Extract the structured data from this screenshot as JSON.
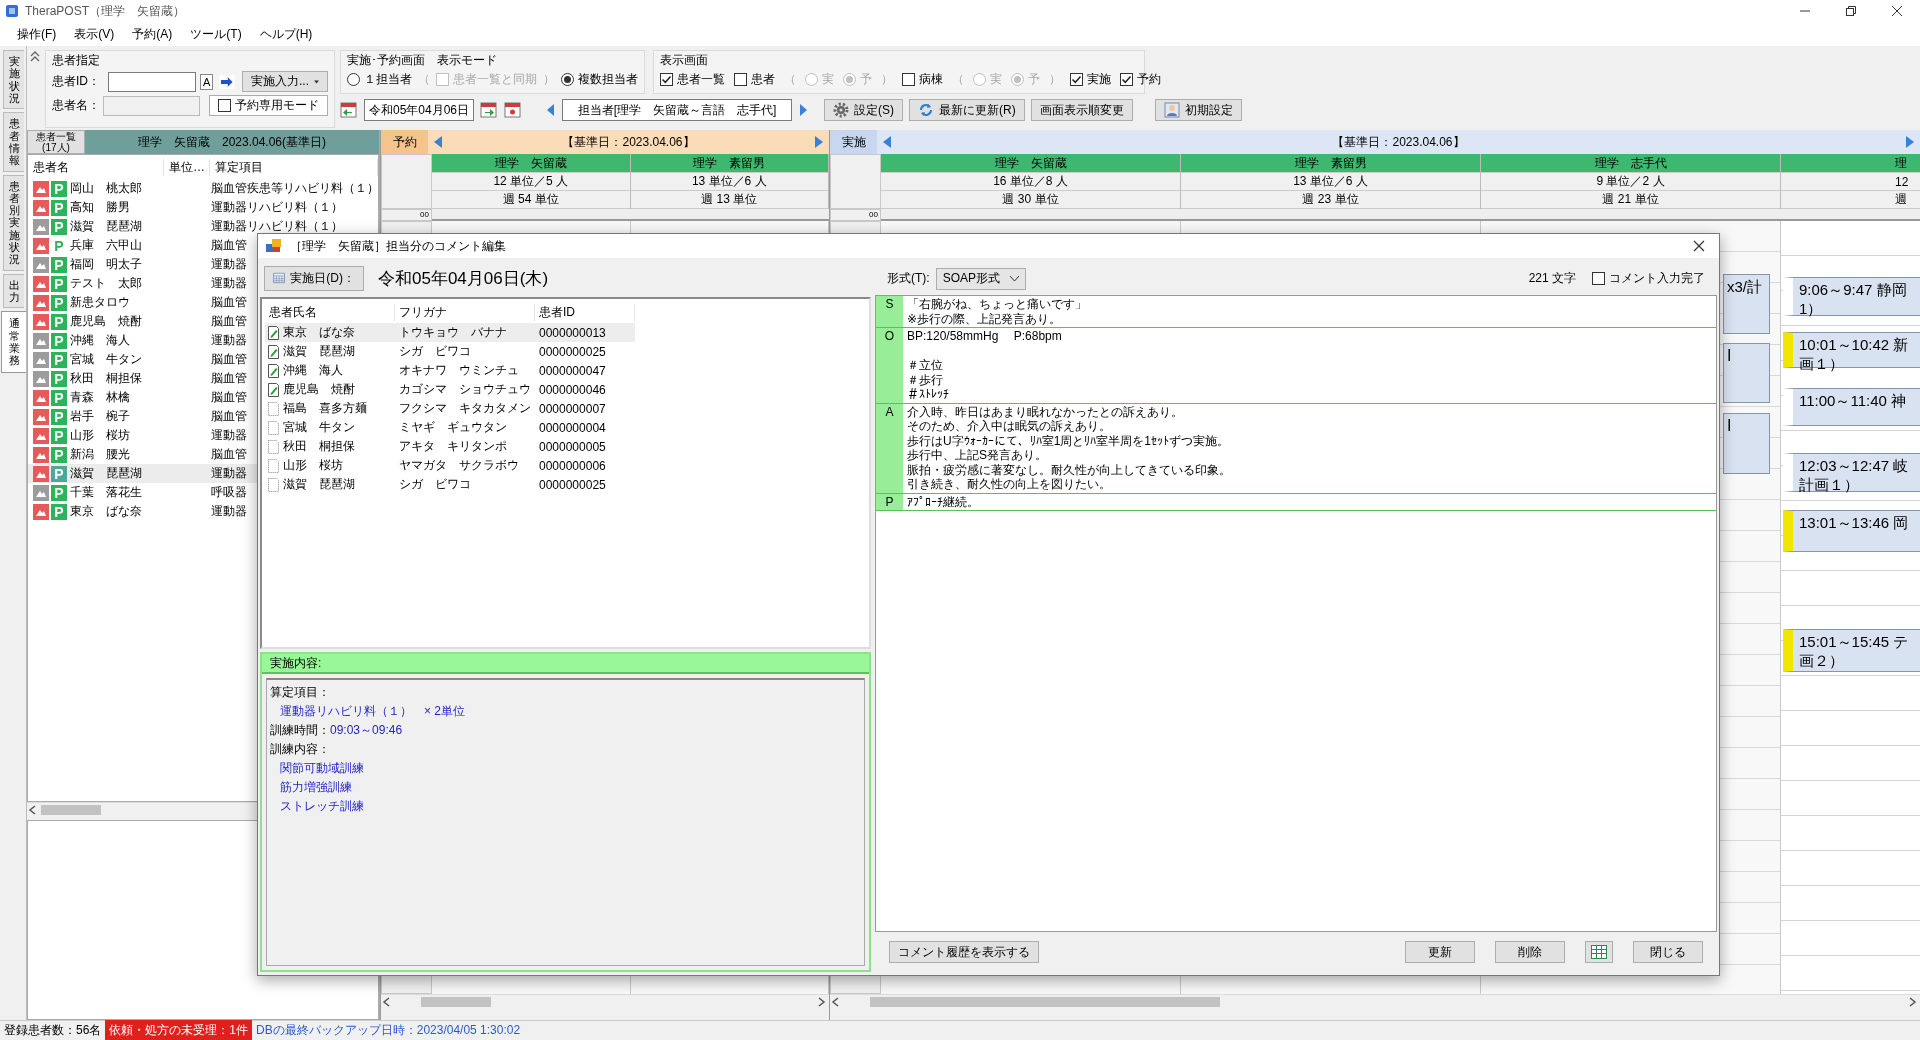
{
  "window": {
    "title": "TheraPOST（理学　矢留蔵）"
  },
  "menu": [
    {
      "label": "操作(F)"
    },
    {
      "label": "表示(V)"
    },
    {
      "label": "予約(A)"
    },
    {
      "label": "ツール(T)"
    },
    {
      "label": "ヘルプ(H)"
    }
  ],
  "side_tabs": [
    {
      "label": "実施状況",
      "selected": false
    },
    {
      "label": "患者情報",
      "selected": false
    },
    {
      "label": "患者別実施状況",
      "selected": false
    },
    {
      "label": "出力",
      "selected": false
    },
    {
      "label": "通常業務",
      "selected": true
    }
  ],
  "patient_spec": {
    "title": "患者指定",
    "id_label": "患者ID：",
    "id_button": "A",
    "input_menu": "実施入力...",
    "name_label": "患者名：",
    "reserve_only": {
      "label": "予約専用モード",
      "checked": false
    }
  },
  "display_mode": {
    "title": "実施･予約画面　表示モード",
    "single": {
      "label": "１担当者",
      "selected": false
    },
    "sync": {
      "open": "（",
      "label": "患者一覧と同期",
      "checked": false,
      "disabled": true,
      "close": "）"
    },
    "multi": {
      "label": "複数担当者",
      "selected": true
    }
  },
  "view_panel": {
    "title": "表示画面",
    "items": [
      {
        "label": "患者一覧",
        "checked": true
      },
      {
        "label": "患者",
        "checked": false,
        "open": "（",
        "modes": [
          {
            "label": "実",
            "selected": false
          },
          {
            "label": "予",
            "selected": true
          }
        ],
        "modes_disabled": true,
        "close": "）"
      },
      {
        "label": "病棟",
        "checked": false,
        "open": "（",
        "modes": [
          {
            "label": "実",
            "selected": false
          },
          {
            "label": "予",
            "selected": true
          }
        ],
        "modes_disabled": true,
        "close": "）"
      },
      {
        "label": "実施",
        "checked": true
      },
      {
        "label": "予約",
        "checked": true
      }
    ]
  },
  "date_nav": {
    "date": "令和05年04月06日",
    "staff_range": "担当者[理学　矢留蔵～言語　志手代]"
  },
  "toolbar_buttons": [
    {
      "kind": "settings",
      "label": "設定(S)"
    },
    {
      "kind": "refresh",
      "label": "最新に更新(R)"
    },
    {
      "kind": "plain",
      "label": "画面表示順変更"
    },
    {
      "kind": "person",
      "label": "初期設定"
    }
  ],
  "patient_panel": {
    "count_button": "患者一覧\n(17人)",
    "header": "理学　矢留蔵　2023.04.06(基準日)",
    "columns": [
      "患者名",
      "単位…",
      "算定項目"
    ],
    "rows": [
      {
        "name": "岡山　桃太郎",
        "color": "#e45b5b",
        "badge": "P",
        "badge_filled": true,
        "item": "脳血管疾患等リハビリ料（１）",
        "selected": false
      },
      {
        "name": "高知　勝男",
        "color": "#e45b5b",
        "badge": "P",
        "badge_filled": true,
        "item": "運動器リハビリ料（１）",
        "selected": false
      },
      {
        "name": "滋賀　琵琶湖",
        "color": "#9c9c9c",
        "badge": "P",
        "badge_filled": true,
        "item": "運動器リハビリ料（１）",
        "selected": false
      },
      {
        "name": "兵庫　六甲山",
        "color": "#e45b5b",
        "badge": "P",
        "badge_filled": false,
        "item": "脳血管",
        "selected": false
      },
      {
        "name": "福岡　明太子",
        "color": "#9c9c9c",
        "badge": "P",
        "badge_filled": true,
        "item": "運動器",
        "selected": false
      },
      {
        "name": "テスト　太郎",
        "color": "#e45b5b",
        "badge": "P",
        "badge_filled": true,
        "item": "運動器",
        "selected": false
      },
      {
        "name": "新患タロウ",
        "color": "#e45b5b",
        "badge": "P",
        "badge_filled": true,
        "item": "脳血管",
        "selected": false
      },
      {
        "name": "鹿児島　焼酎",
        "color": "#e45b5b",
        "badge": "P",
        "badge_filled": true,
        "item": "脳血管",
        "selected": false
      },
      {
        "name": "沖縄　海人",
        "color": "#9c9c9c",
        "badge": "P",
        "badge_filled": true,
        "item": "運動器",
        "selected": false
      },
      {
        "name": "宮城　牛タン",
        "color": "#9c9c9c",
        "badge": "P",
        "badge_filled": true,
        "item": "脳血管",
        "selected": false
      },
      {
        "name": "秋田　桐担保",
        "color": "#9c9c9c",
        "badge": "P",
        "badge_filled": true,
        "item": "脳血管",
        "selected": false
      },
      {
        "name": "青森　林檎",
        "color": "#e45b5b",
        "badge": "P",
        "badge_filled": true,
        "item": "脳血管",
        "selected": false
      },
      {
        "name": "岩手　椀子",
        "color": "#e45b5b",
        "badge": "P",
        "badge_filled": true,
        "item": "脳血管",
        "selected": false
      },
      {
        "name": "山形　桜坊",
        "color": "#e45b5b",
        "badge": "P",
        "badge_filled": true,
        "item": "運動器",
        "selected": false
      },
      {
        "name": "新潟　腰光",
        "color": "#e45b5b",
        "badge": "P",
        "badge_filled": true,
        "item": "脳血管",
        "selected": false
      },
      {
        "name": "滋賀　琵琶湖",
        "color": "#e45b5b",
        "badge": "P",
        "badge_filled": true,
        "item": "運動器",
        "selected": true
      },
      {
        "name": "千葉　落花生",
        "color": "#9c9c9c",
        "badge": "P",
        "badge_filled": true,
        "item": "呼吸器",
        "selected": false
      },
      {
        "name": "東京　ばな奈",
        "color": "#e45b5b",
        "badge": "P",
        "badge_filled": true,
        "item": "運動器",
        "selected": false
      }
    ]
  },
  "schedule": {
    "reserve": {
      "label": "予約",
      "base_date": "【基準日：2023.04.06】",
      "time_marker": "00",
      "staff": [
        {
          "name": "理学　矢留蔵",
          "units": "12 単位／5 人",
          "week": "週 54 単位"
        },
        {
          "name": "理学　素留男",
          "units": "13 単位／6 人",
          "week": "週 13 単位"
        }
      ]
    },
    "actual": {
      "label": "実施",
      "base_date": "【基準日：2023.04.06】",
      "time_marker": "00",
      "staff": [
        {
          "name": "理学　矢留蔵",
          "units": "16 単位／8 人",
          "week": "週 30 単位"
        },
        {
          "name": "理学　素留男",
          "units": "13 単位／6 人",
          "week": "週 23 単位"
        },
        {
          "name": "理学　志手代",
          "units": "9 単位／2 人",
          "week": "週 21 単位",
          "events": [
            {
              "lines": [
                "x3/計"
              ]
            },
            {
              "lines": [
                "Ⅰ"
              ]
            },
            {
              "lines": [
                "Ⅰ"
              ]
            }
          ]
        },
        {
          "name": "理",
          "units": "12",
          "week": "週",
          "events": [
            {
              "lines": [
                "9:06～9:47 静岡",
                "1）"
              ],
              "flagged": false
            },
            {
              "lines": [
                "10:01～10:42 新",
                "画１）"
              ],
              "flagged": true
            },
            {
              "lines": [
                "11:00～11:40 神"
              ],
              "flagged": false
            },
            {
              "lines": [
                "12:03～12:47 岐",
                "計画１）"
              ],
              "flagged": false
            },
            {
              "lines": [
                "13:01～13:46 岡"
              ],
              "flagged": true
            },
            {
              "lines": [
                "15:01～15:45 テ",
                "画２）"
              ],
              "flagged": true
            }
          ]
        }
      ]
    }
  },
  "dialog": {
    "title": "［理学　矢留蔵］担当分のコメント編集",
    "date_button": "実施日(D)：",
    "date": "令和05年04月06日(木)",
    "columns": [
      "患者氏名",
      "フリガナ",
      "患者ID"
    ],
    "rows": [
      {
        "name": "東京　ばな奈",
        "kana": "トウキョウ　バナナ",
        "id": "0000000013",
        "commented": true,
        "selected": true
      },
      {
        "name": "滋賀　琵琶湖",
        "kana": "シガ　ビワコ",
        "id": "0000000025",
        "commented": true,
        "selected": false
      },
      {
        "name": "沖縄　海人",
        "kana": "オキナワ　ウミンチュ",
        "id": "0000000047",
        "commented": true,
        "selected": false
      },
      {
        "name": "鹿児島　焼酎",
        "kana": "カゴシマ　ショウチュウ",
        "id": "0000000046",
        "commented": true,
        "selected": false
      },
      {
        "name": "福島　喜多方麺",
        "kana": "フクシマ　キタカタメン",
        "id": "0000000007",
        "commented": false,
        "selected": false
      },
      {
        "name": "宮城　牛タン",
        "kana": "ミヤギ　ギュウタン",
        "id": "0000000004",
        "commented": false,
        "selected": false
      },
      {
        "name": "秋田　桐担保",
        "kana": "アキタ　キリタンポ",
        "id": "0000000005",
        "commented": false,
        "selected": false
      },
      {
        "name": "山形　桜坊",
        "kana": "ヤマガタ　サクラボウ",
        "id": "0000000006",
        "commented": false,
        "selected": false
      },
      {
        "name": "滋賀　琵琶湖",
        "kana": "シガ　ビワコ",
        "id": "0000000025",
        "commented": false,
        "selected": false
      }
    ],
    "details": {
      "title": "実施内容:",
      "sections": [
        {
          "label": "算定項目：",
          "items": [
            "運動器リハビリ料（１）　× 2単位"
          ]
        },
        {
          "label": "訓練時間：",
          "value": "09:03～09:46"
        },
        {
          "label": "訓練内容：",
          "items": [
            "関節可動域訓練",
            "筋力増強訓練",
            "ストレッチ訓練"
          ]
        }
      ]
    },
    "format_label": "形式(T):",
    "format": "SOAP形式",
    "char_count": "221 文字",
    "complete": {
      "label": "コメント入力完了",
      "checked": false
    },
    "soap": [
      {
        "letter": "S",
        "lines": [
          {
            "text": "「右腕がね、ちょっと痛いです」"
          },
          {
            "text": "※歩行の際、上記発言あり。"
          }
        ]
      },
      {
        "letter": "O",
        "lines": [
          {
            "text": "BP:120/58mmHg　 P:68bpm"
          },
          {
            "text": "＃立位",
            "gap_before": true
          },
          {
            "text": "＃歩行"
          },
          {
            "text": "＃ｽﾄﾚｯﾁ"
          }
        ]
      },
      {
        "letter": "A",
        "lines": [
          {
            "text": "介入時、昨日はあまり眠れなかったとの訴えあり。"
          },
          {
            "text": "そのため、介入中は眠気の訴えあり。"
          },
          {
            "text": "歩行はU字ｳｫｰｶｰにて、ﾘﾊ室1周とﾘﾊ室半周を1ｾｯﾄずつ実施。"
          },
          {
            "text": "歩行中、上記S発言あり。"
          },
          {
            "text": "脈拍・疲労感に著変なし。耐久性が向上してきている印象。"
          },
          {
            "text": "引き続き、耐久性の向上を図りたい。"
          }
        ]
      },
      {
        "letter": "P",
        "lines": [
          {
            "text": "ｱﾌﾟﾛｰﾁ継続。"
          }
        ]
      }
    ],
    "buttons": [
      {
        "kind": "text",
        "label": "コメント履歴を表示する"
      },
      {
        "kind": "text",
        "label": "更新"
      },
      {
        "kind": "text",
        "label": "削除"
      },
      {
        "kind": "grid"
      },
      {
        "kind": "text",
        "label": "閉じる"
      }
    ]
  },
  "status_bar": {
    "patients": "登録患者数：56名",
    "alert": "依頼・処方の未受理：1件",
    "backup": "DBの最終バックアップ日時：2023/04/05 1:30:02"
  }
}
